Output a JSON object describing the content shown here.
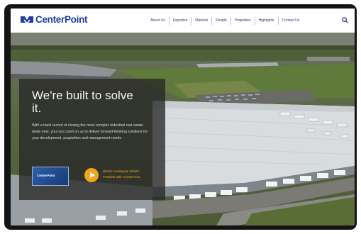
{
  "brand": {
    "name": "CenterPoint",
    "color": "#1f3f9e"
  },
  "nav": {
    "items": [
      {
        "label": "About Us"
      },
      {
        "label": "Expertise"
      },
      {
        "label": "Markets"
      },
      {
        "label": "People"
      },
      {
        "label": "Properties"
      },
      {
        "label": "Highlights"
      },
      {
        "label": "Contact Us"
      }
    ],
    "search_icon": "search-icon"
  },
  "hero": {
    "title": "We're built to solve it.",
    "body": "With a track record of closing the most complex industrial real estate deals ever, you can count on us to deliver forward-thinking solutions for your development, acquisition and management needs.",
    "thumbnail_label": "CenterPoint",
    "video_link": "Watch Investigate What's Possible with CenterPoint",
    "accent_color": "#f0a51c"
  }
}
